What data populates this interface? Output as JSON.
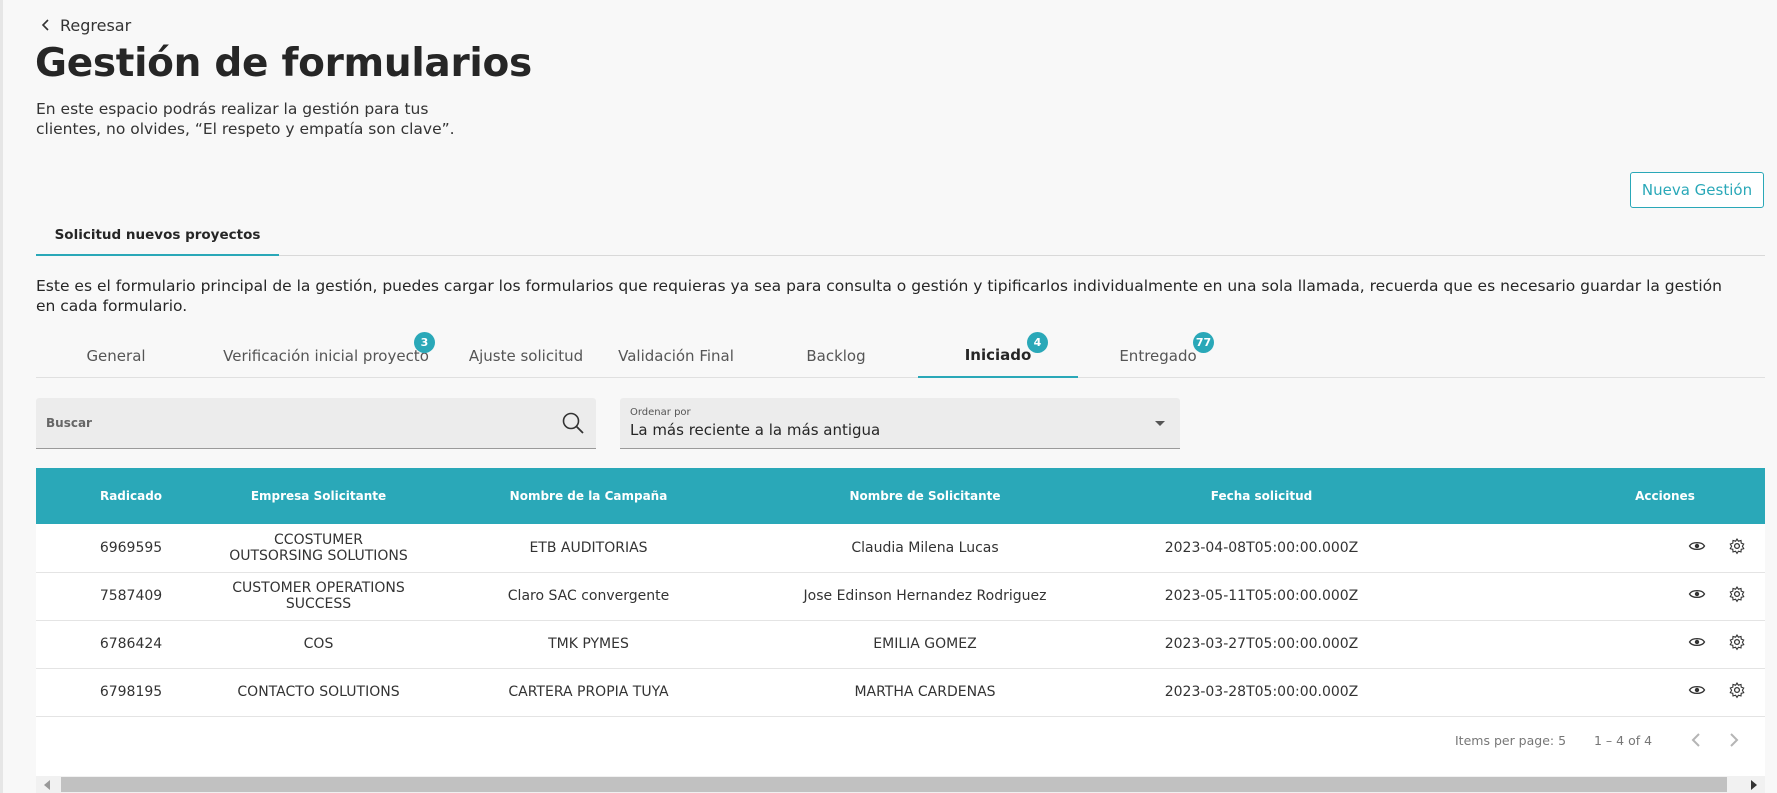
{
  "header": {
    "back_label": "Regresar",
    "title": "Gestión de formularios",
    "description": "En este espacio podrás realizar la gestión para tus clientes, no olvides, “El respeto y empatía son clave”.",
    "new_button_label": "Nueva Gestión"
  },
  "main_tabs": [
    {
      "label": "Solicitud nuevos proyectos",
      "active": true
    }
  ],
  "form_description": "Este es el formulario principal de la gestión, puedes cargar los formularios que requieras ya sea para consulta o gestión y tipificarlos individualmente en una sola llamada, recuerda que es necesario guardar la gestión en cada formulario.",
  "sub_tabs": [
    {
      "label": "General"
    },
    {
      "label": "Verificación inicial proyecto",
      "badge": "3"
    },
    {
      "label": "Ajuste solicitud"
    },
    {
      "label": "Validación Final"
    },
    {
      "label": "Backlog"
    },
    {
      "label": "Iniciado",
      "badge": "4",
      "active": true
    },
    {
      "label": "Entregado",
      "badge": "77"
    }
  ],
  "search": {
    "placeholder": "Buscar"
  },
  "sort": {
    "label": "Ordenar por",
    "value": "La más reciente a la más antigua"
  },
  "table": {
    "headers": [
      "Radicado",
      "Empresa Solicitante",
      "Nombre de la Campaña",
      "Nombre de Solicitante",
      "Fecha solicitud",
      "Acciones"
    ],
    "rows": [
      [
        "6969595",
        "CCOSTUMER OUTSORSING SOLUTIONS",
        "ETB AUDITORIAS",
        "Claudia Milena Lucas",
        "2023-04-08T05:00:00.000Z"
      ],
      [
        "7587409",
        "CUSTOMER OPERATIONS SUCCESS",
        "Claro SAC convergente",
        "Jose Edinson Hernandez Rodriguez",
        "2023-05-11T05:00:00.000Z"
      ],
      [
        "6786424",
        "COS",
        "TMK PYMES",
        "EMILIA GOMEZ",
        "2023-03-27T05:00:00.000Z"
      ],
      [
        "6798195",
        "CONTACTO SOLUTIONS",
        "CARTERA PROPIA TUYA",
        "MARTHA CARDENAS",
        "2023-03-28T05:00:00.000Z"
      ]
    ]
  },
  "paginator": {
    "items_per_page": "Items per page: 5",
    "range": "1 – 4 of 4"
  },
  "colors": {
    "accent": "#2aa8b8"
  }
}
